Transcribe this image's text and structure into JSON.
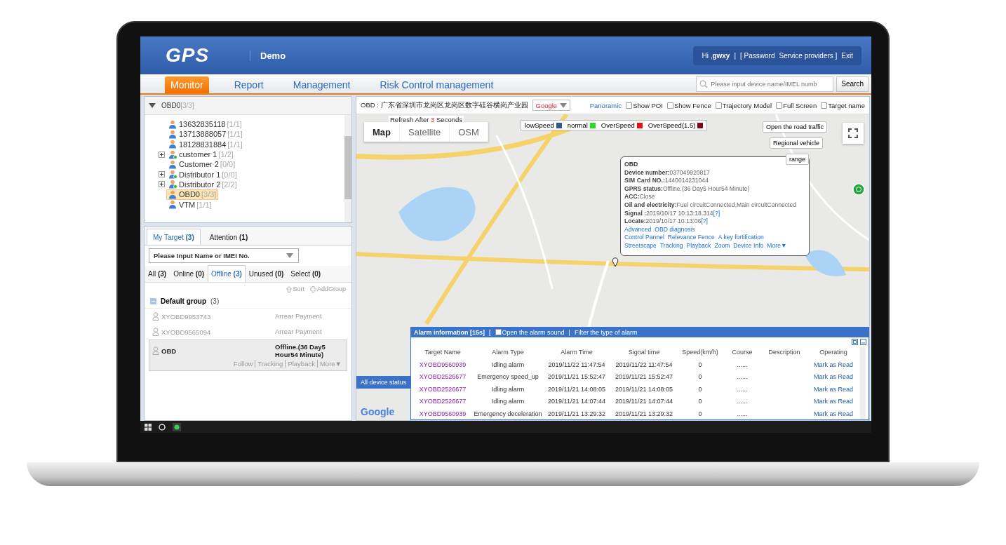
{
  "header": {
    "logo": "GPS",
    "title": "Demo",
    "greeting": "Hi ,",
    "user": "gwxy",
    "separator": "|",
    "links": [
      "[ Password",
      "Service providers ]",
      "Exit"
    ]
  },
  "nav": {
    "tabs": [
      {
        "label": "Monitor",
        "selected": true
      },
      {
        "label": "Report",
        "selected": false
      },
      {
        "label": "Management",
        "selected": false
      },
      {
        "label": "Risk Control management",
        "selected": false
      }
    ],
    "search": {
      "placeholder": "Please input device name/IMEL numb",
      "button": "Search"
    }
  },
  "tree": {
    "root": {
      "label": "OBD0",
      "count": "[3/3]"
    },
    "items": [
      {
        "label": "13632835118",
        "count": "[1/1]",
        "kind": "user",
        "selected": false
      },
      {
        "label": "13713888057",
        "count": "[1/1]",
        "kind": "user",
        "selected": false
      },
      {
        "label": "18128831884",
        "count": "[1/1]",
        "kind": "user",
        "selected": false
      },
      {
        "label": "customer 1",
        "count": "[1/2]",
        "kind": "group",
        "selected": false
      },
      {
        "label": "Customer 2",
        "count": "[0/0]",
        "kind": "user",
        "selected": false
      },
      {
        "label": "Distributor 1",
        "count": "[0/0]",
        "kind": "group",
        "selected": false
      },
      {
        "label": "Distributor 2",
        "count": "[2/2]",
        "kind": "group",
        "selected": false
      },
      {
        "label": "OBD0",
        "count": "[3/3]",
        "kind": "user",
        "selected": true
      },
      {
        "label": "VTM",
        "count": "[1/1]",
        "kind": "user",
        "selected": false
      }
    ]
  },
  "targets": {
    "tabs": [
      {
        "label": "My Target",
        "count": "(3)",
        "selected": true
      },
      {
        "label": "Attention",
        "count": "(1)",
        "selected": false
      }
    ],
    "search": {
      "placeholder": "Please Input Name or IMEI No."
    },
    "filters": [
      {
        "label": "All",
        "count": "(3)",
        "selected": false
      },
      {
        "label": "Online",
        "count": "(0)",
        "selected": false
      },
      {
        "label": "Offline",
        "count": "(3)",
        "selected": true
      },
      {
        "label": "Unused",
        "count": "(0)",
        "selected": false
      },
      {
        "label": "Select",
        "count": "(0)",
        "selected": false
      }
    ],
    "sort": "Sort",
    "add_group": "AddGroup",
    "group": {
      "name": "Default group",
      "count": "(3)",
      "expanded": true,
      "devices": [
        {
          "name": "XYOBD9953743",
          "status": "Arrear  Payment",
          "selected": false
        },
        {
          "name": "XYOBD9565094",
          "status": "Arrear  Payment",
          "selected": false
        },
        {
          "name": "OBD",
          "status": "Offline.(36 Day5 Hour54 Minute)",
          "selected": true,
          "actions": [
            "Follow",
            "Tracking",
            "Playback",
            "More▼"
          ]
        }
      ]
    }
  },
  "all_device_status": "All device status",
  "map_toolbar": {
    "device_label": "OBD : 广东省深圳市龙岗区龙岗区数字硅谷横岗产业园",
    "provider": "Google",
    "panoramic": "Panoramic",
    "options": [
      {
        "label": "Show POI",
        "checked": false
      },
      {
        "label": "Show Fence",
        "checked": false
      },
      {
        "label": "Trajectory Model",
        "checked": false
      },
      {
        "label": "Full Screen",
        "checked": false
      },
      {
        "label": "Target name",
        "checked": false
      }
    ]
  },
  "map": {
    "refresh": {
      "prefix": "Refresh After",
      "count": "3",
      "suffix": "Seconds"
    },
    "map_types": [
      {
        "label": "Map",
        "selected": true
      },
      {
        "label": "Satellite",
        "selected": false
      },
      {
        "label": "OSM",
        "selected": false
      }
    ],
    "legend": [
      {
        "label": "lowSpeed",
        "color": "#335a8c"
      },
      {
        "label": "normal",
        "color": "#22dd22"
      },
      {
        "label": "OverSpeed",
        "color": "#e81010"
      },
      {
        "label": "OverSpeed(1.5)",
        "color": "#7a0a1e"
      }
    ],
    "buttons": [
      "Open the road traffic",
      "Regional vehicle",
      "range"
    ],
    "attribution": "Google",
    "popup": {
      "title": "OBD",
      "fields": [
        {
          "label": "Device number:",
          "value": "037049920817"
        },
        {
          "label": "SIM Card NO.:",
          "value": "1440014231044"
        },
        {
          "label": "GPRS status:",
          "value": "Offline.(36 Day5 Hour54 Minute)"
        },
        {
          "label": "ACC:",
          "value": "Close"
        },
        {
          "label": "Oil and electricity:",
          "value": "Fuel circuitConnected,Main circuitConnected"
        },
        {
          "label": "Signal :",
          "value": "2019/10/17 10:13:18.314",
          "help": "[?]"
        },
        {
          "label": "Locate:",
          "value": "2019/10/17 10:13:06",
          "help": "[?]"
        }
      ],
      "link_rows": [
        [
          "Advanced",
          "OBD diagnosis"
        ],
        [
          "Control Pannel",
          "Relevance Fence",
          "A key fortification"
        ],
        [
          "Streetscape",
          "Tracking",
          "Playback",
          "Zoom",
          "Device Info",
          "More▼"
        ]
      ]
    }
  },
  "alarm": {
    "title": "Alarm information [15s]",
    "bracket": "[",
    "sound": {
      "label": "Open the alarm sound",
      "checked": false
    },
    "separator": "|",
    "filter": "Filter the type of alarm",
    "columns": [
      "Target Name",
      "Alarm Type",
      "Alarm Time",
      "Signal time",
      "Speed(km/h)",
      "Course",
      "Description",
      "Operating"
    ],
    "rows": [
      {
        "target": "XYOBD9560939",
        "type": "Idling alarm",
        "alarm_time": "2019/11/22 11:47:54",
        "signal_time": "2019/11/22 11:47:54",
        "speed": "0",
        "course": "......",
        "operating": "Mark as Read"
      },
      {
        "target": "XYOBD2526677",
        "type": "Emergency speed_up",
        "alarm_time": "2019/11/21 15:52:47",
        "signal_time": "2019/11/21 15:52:47",
        "speed": "0",
        "course": "......",
        "operating": "Mark as Read"
      },
      {
        "target": "XYOBD2526677",
        "type": "Idling alarm",
        "alarm_time": "2019/11/21 14:08:05",
        "signal_time": "2019/11/21 14:08:05",
        "speed": "0",
        "course": "......",
        "operating": "Mark as Read"
      },
      {
        "target": "XYOBD2526677",
        "type": "Idling alarm",
        "alarm_time": "2019/11/21 14:07:44",
        "signal_time": "2019/11/21 14:07:44",
        "speed": "0",
        "course": "......",
        "operating": "Mark as Read"
      },
      {
        "target": "XYOBD9560939",
        "type": "Emergency deceleration",
        "alarm_time": "2019/11/21 13:29:32",
        "signal_time": "2019/11/21 13:29:32",
        "speed": "0",
        "course": "......",
        "operating": "Mark as Read"
      }
    ]
  }
}
